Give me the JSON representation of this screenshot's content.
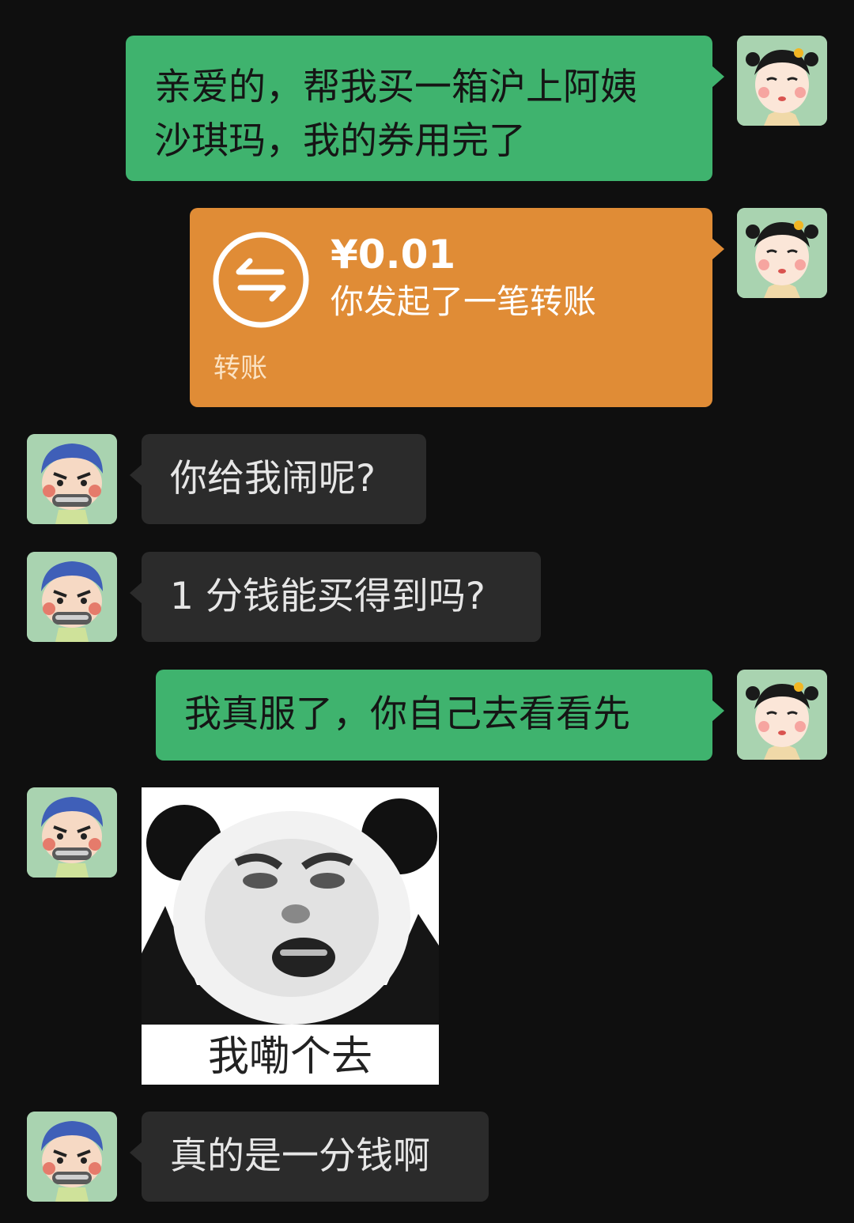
{
  "messages": {
    "m1": {
      "sender": "me",
      "line1": "亲爱的，帮我买一箱沪上阿姨",
      "line2": "沙琪玛，我的券用完了"
    },
    "m2": {
      "sender": "me",
      "amount": "¥0.01",
      "status": "你发起了一笔转账",
      "label": "转账"
    },
    "m3": {
      "sender": "other",
      "text": "你给我闹呢?"
    },
    "m4": {
      "sender": "other",
      "text": "1 分钱能买得到吗?"
    },
    "m5": {
      "sender": "me",
      "text": "我真服了，你自己去看看先"
    },
    "m6": {
      "sender": "other",
      "caption": "我嘞个去"
    },
    "m7": {
      "sender": "other",
      "text": "真的是一分钱啊"
    }
  },
  "colors": {
    "background": "#0f0f0f",
    "bubble_me": "#3fb36e",
    "bubble_other": "#2b2b2b",
    "transfer": "#e08c36"
  },
  "icons": {
    "transfer": "transfer-arrows-icon",
    "avatar_me": "girl-avatar",
    "avatar_other": "boy-avatar"
  }
}
